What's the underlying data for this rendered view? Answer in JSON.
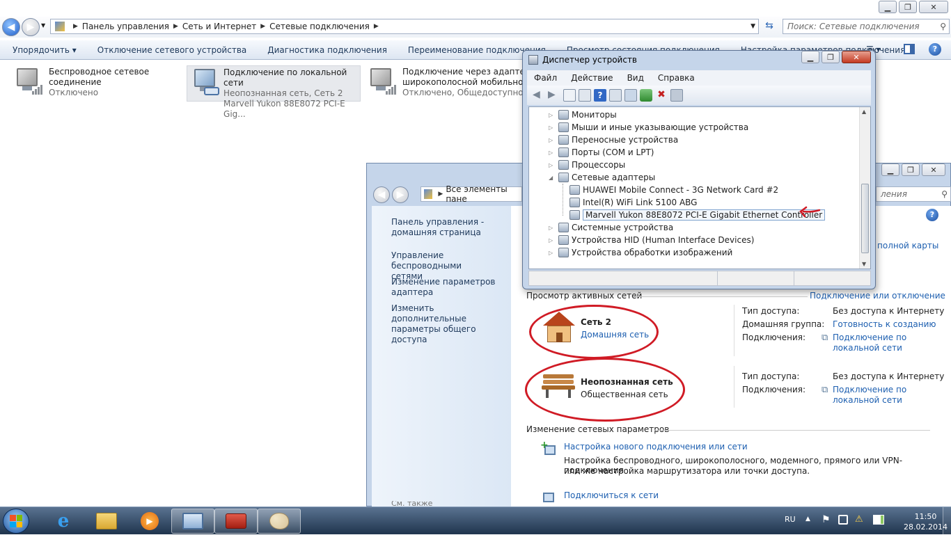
{
  "explorer": {
    "breadcrumb": [
      "Панель управления",
      "Сеть и Интернет",
      "Сетевые подключения"
    ],
    "search_placeholder": "Поиск: Сетевые подключения",
    "commands": [
      "Упорядочить",
      "Отключение сетевого устройства",
      "Диагностика подключения",
      "Переименование подключения",
      "Просмотр состояния подключения",
      "Настройка параметров подключения"
    ],
    "adapters": [
      {
        "name": "Беспроводное сетевое",
        "name2": "соединение",
        "status": "Отключено",
        "device": ""
      },
      {
        "name": "Подключение по локальной сети",
        "name2": "",
        "status": "Неопознанная сеть, Сеть  2",
        "device": "Marvell Yukon 88E8072 PCI-E Gig..."
      },
      {
        "name": "Подключение через адаптер",
        "name2": "широкополосной мобильной",
        "status": "Отключено, Общедоступно",
        "device": ""
      }
    ]
  },
  "device_manager": {
    "title": "Диспетчер устройств",
    "menu": [
      "Файл",
      "Действие",
      "Вид",
      "Справка"
    ],
    "tree": [
      {
        "label": "Мониторы",
        "level": 0
      },
      {
        "label": "Мыши и иные указывающие устройства",
        "level": 0
      },
      {
        "label": "Переносные устройства",
        "level": 0
      },
      {
        "label": "Порты (COM и LPT)",
        "level": 0
      },
      {
        "label": "Процессоры",
        "level": 0
      },
      {
        "label": "Сетевые адаптеры",
        "level": 0
      },
      {
        "label": "HUAWEI Mobile Connect - 3G Network Card #2",
        "level": 1
      },
      {
        "label": "Intel(R) WiFi Link 5100 ABG",
        "level": 1
      },
      {
        "label": "Marvell Yukon 88E8072 PCI-E Gigabit Ethernet Controller",
        "level": 1
      },
      {
        "label": "Системные устройства",
        "level": 0
      },
      {
        "label": "Устройства HID (Human Interface Devices)",
        "level": 0
      },
      {
        "label": "Устройства обработки изображений",
        "level": 0
      }
    ]
  },
  "network_center": {
    "address": "Все элементы пане",
    "search_tail": "ления",
    "left_links": [
      {
        "l1": "Панель управления -",
        "l2": "домашняя страница"
      },
      {
        "l1": "Управление беспроводными",
        "l2": "сетями"
      },
      {
        "l1": "Изменение параметров",
        "l2": "адаптера"
      },
      {
        "l1": "Изменить дополнительные",
        "l2": "параметры общего доступа"
      }
    ],
    "see_also": "См. также",
    "full_map": "полной карты",
    "active_networks_title": "Просмотр активных сетей",
    "connect_disconnect": "Подключение или отключение",
    "net1": {
      "name": "Сеть  2",
      "type": "Домашняя сеть",
      "access_label": "Тип доступа:",
      "access": "Без доступа к Интернету",
      "homegroup_label": "Домашняя группа:",
      "homegroup": "Готовность к созданию",
      "conn_label": "Подключения:",
      "conn1": "Подключение по",
      "conn2": "локальной сети"
    },
    "net2": {
      "name": "Неопознанная сеть",
      "type": "Общественная сеть",
      "access_label": "Тип доступа:",
      "access": "Без доступа к Интернету",
      "conn_label": "Подключения:",
      "conn1": "Подключение по",
      "conn2": "локальной сети"
    },
    "change_title": "Изменение сетевых параметров",
    "task1": {
      "title": "Настройка нового подключения или сети",
      "d1": "Настройка беспроводного, широкополосного, модемного, прямого или VPN-подключения",
      "d2": "или же настройка маршрутизатора или точки доступа."
    },
    "task2": {
      "title": "Подключиться к сети"
    }
  },
  "taskbar": {
    "lang": "RU",
    "time": "11:50",
    "date": "28.02.2014"
  }
}
